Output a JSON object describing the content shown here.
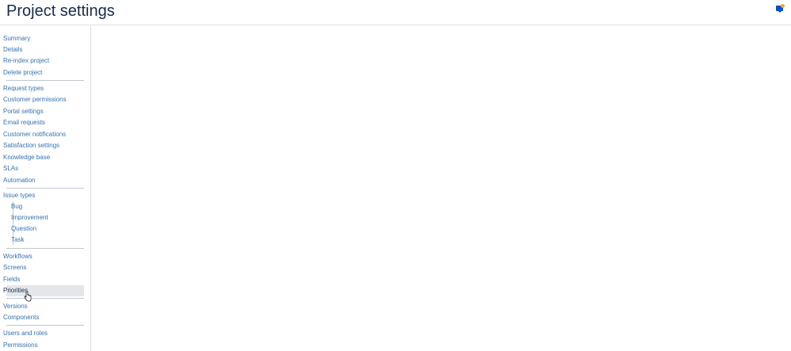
{
  "header": {
    "title": "Project settings",
    "feedback_icon": "feedback-icon"
  },
  "colors": {
    "link": "#3572b0",
    "selected_bg": "#e4e6ea",
    "text": "#172b4d",
    "divider": "#c1c7d0",
    "badge": "#f5a623",
    "icon": "#0052cc"
  },
  "sidebar": {
    "items": [
      {
        "label": "Summary"
      },
      {
        "label": "Details"
      },
      {
        "label": "Re-index project"
      },
      {
        "label": "Delete project"
      },
      {
        "label": "Request types"
      },
      {
        "label": "Customer permissions"
      },
      {
        "label": "Portal settings"
      },
      {
        "label": "Email requests"
      },
      {
        "label": "Customer notifications"
      },
      {
        "label": "Satisfaction settings"
      },
      {
        "label": "Knowledge base"
      },
      {
        "label": "SLAs"
      },
      {
        "label": "Automation"
      },
      {
        "label": "Issue types"
      },
      {
        "label": "Bug"
      },
      {
        "label": "Improvement"
      },
      {
        "label": "Question"
      },
      {
        "label": "Task"
      },
      {
        "label": "Workflows"
      },
      {
        "label": "Screens"
      },
      {
        "label": "Fields"
      },
      {
        "label": "Priorities",
        "selected": true
      },
      {
        "label": "Versions"
      },
      {
        "label": "Components"
      },
      {
        "label": "Users and roles"
      },
      {
        "label": "Permissions"
      }
    ]
  }
}
